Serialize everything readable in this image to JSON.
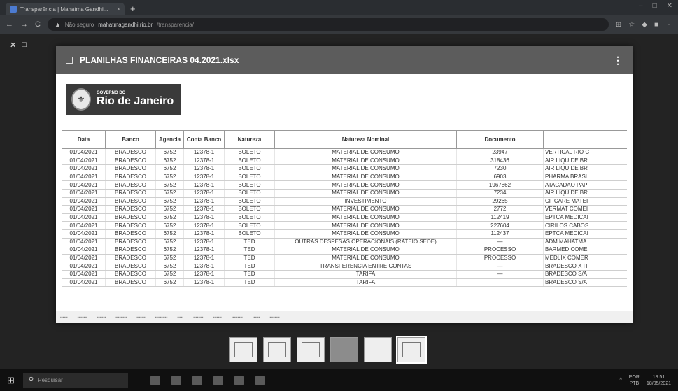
{
  "browser": {
    "tab_title": "Transparência | Mahatma Gandhi...",
    "tab_close": "×",
    "new_tab": "+",
    "security_label": "Não seguro",
    "url_domain": "mahatmagandhi.rio.br",
    "url_path": "/transparencia/",
    "back": "←",
    "forward": "→",
    "reload": "C",
    "warning": "▲",
    "win_min": "–",
    "win_max": "□",
    "win_close": "✕",
    "toolbar_icons": [
      "⊞",
      "☆",
      "◆",
      "■",
      "⋮"
    ]
  },
  "viewer": {
    "close": "✕",
    "layout": "□",
    "doc_title": "PLANILHAS FINANCEIRAS 04.2021.xlsx",
    "menu": "⋮"
  },
  "logo": {
    "small": "GOVERNO DO",
    "big": "Rio de Janeiro"
  },
  "table": {
    "headers": [
      "Data",
      "Banco",
      "Agencia",
      "Conta Banco",
      "Natureza",
      "Natureza Nominal",
      "Documento",
      ""
    ],
    "rows": [
      [
        "01/04/2021",
        "BRADESCO",
        "6752",
        "12378-1",
        "BOLETO",
        "MATERIAL DE CONSUMO",
        "23947",
        "VERTICAL RIO C"
      ],
      [
        "01/04/2021",
        "BRADESCO",
        "6752",
        "12378-1",
        "BOLETO",
        "MATERIAL DE CONSUMO",
        "318436",
        "AIR LIQUIDE BR"
      ],
      [
        "01/04/2021",
        "BRADESCO",
        "6752",
        "12378-1",
        "BOLETO",
        "MATERIAL DE CONSUMO",
        "7230",
        "AIR LIQUIDE BR"
      ],
      [
        "01/04/2021",
        "BRADESCO",
        "6752",
        "12378-1",
        "BOLETO",
        "MATERIAL DE CONSUMO",
        "6903",
        "PHARMA BRASI"
      ],
      [
        "01/04/2021",
        "BRADESCO",
        "6752",
        "12378-1",
        "BOLETO",
        "MATERIAL DE CONSUMO",
        "1967862",
        "ATACADAO PAP"
      ],
      [
        "01/04/2021",
        "BRADESCO",
        "6752",
        "12378-1",
        "BOLETO",
        "MATERIAL DE CONSUMO",
        "7234",
        "AIR LIQUIDE BR"
      ],
      [
        "01/04/2021",
        "BRADESCO",
        "6752",
        "12378-1",
        "BOLETO",
        "INVESTIMENTO",
        "29265",
        "CF CARE MATEI"
      ],
      [
        "01/04/2021",
        "BRADESCO",
        "6752",
        "12378-1",
        "BOLETO",
        "MATERIAL DE CONSUMO",
        "2772",
        "VERMAT COMEI"
      ],
      [
        "01/04/2021",
        "BRADESCO",
        "6752",
        "12378-1",
        "BOLETO",
        "MATERIAL DE CONSUMO",
        "112419",
        "EPTCA MEDICAI"
      ],
      [
        "01/04/2021",
        "BRADESCO",
        "6752",
        "12378-1",
        "BOLETO",
        "MATERIAL DE CONSUMO",
        "227604",
        "CIRILOS CABOS"
      ],
      [
        "01/04/2021",
        "BRADESCO",
        "6752",
        "12378-1",
        "BOLETO",
        "MATERIAL DE CONSUMO",
        "112437",
        "EPTCA MEDICAI"
      ],
      [
        "01/04/2021",
        "BRADESCO",
        "6752",
        "12378-1",
        "TED",
        "OUTRAS DESPESAS OPERACIONAIS (RATEIO SEDE)",
        "—",
        "ADM MAHATMA"
      ],
      [
        "01/04/2021",
        "BRADESCO",
        "6752",
        "12378-1",
        "TED",
        "MATERIAL DE CONSUMO",
        "PROCESSO",
        "BARMED COME"
      ],
      [
        "01/04/2021",
        "BRADESCO",
        "6752",
        "12378-1",
        "TED",
        "MATERIAL DE CONSUMO",
        "PROCESSO",
        "MEDLIX COMER"
      ],
      [
        "01/04/2021",
        "BRADESCO",
        "6752",
        "12378-1",
        "TED",
        "TRANSFERENCIA ENTRE CONTAS",
        "—",
        "BRADESCO X IT"
      ],
      [
        "01/04/2021",
        "BRADESCO",
        "6752",
        "12378-1",
        "TED",
        "TARIFA",
        "—",
        "BRADESCO S/A"
      ],
      [
        "01/04/2021",
        "BRADESCO",
        "6752",
        "12378-1",
        "TED",
        "TARIFA",
        "",
        "BRADESCO S/A"
      ]
    ]
  },
  "taskbar": {
    "start": "⊞",
    "search_icon": "⚲",
    "search_placeholder": "Pesquisar",
    "lang_line1": "POR",
    "lang_line2": "PTB",
    "time": "18:51",
    "date": "18/05/2021",
    "tray_up": "^"
  },
  "colors": {
    "viewer_header": "#5c5c5c",
    "logo_bg": "#3a3a3a",
    "taskbar": "#101010"
  }
}
